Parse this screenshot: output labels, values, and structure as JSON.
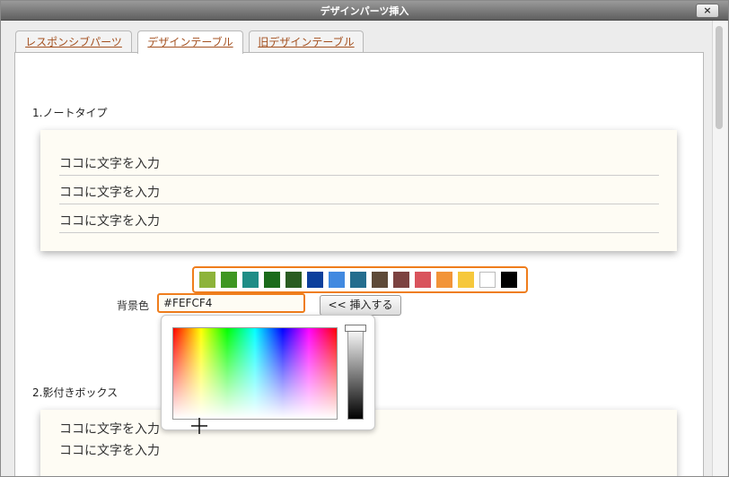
{
  "window": {
    "title": "デザインパーツ挿入",
    "close_label": "×"
  },
  "tabs": [
    {
      "label": "レスポンシブパーツ",
      "active": false
    },
    {
      "label": "デザインテーブル",
      "active": true
    },
    {
      "label": "旧デザインテーブル",
      "active": false
    }
  ],
  "sections": [
    {
      "heading": "1.ノートタイプ",
      "lines": [
        "ココに文字を入力",
        "ココに文字を入力",
        "ココに文字を入力"
      ]
    },
    {
      "heading": "2.影付きボックス",
      "lines": [
        "ココに文字を入力",
        "ココに文字を入力"
      ]
    }
  ],
  "palette": [
    "#8db33a",
    "#3f9622",
    "#1f8d86",
    "#1b6b1a",
    "#2a5c22",
    "#0c3f9c",
    "#4189e0",
    "#246d8e",
    "#5e4a38",
    "#7c4240",
    "#d9535c",
    "#f29438",
    "#f6c83c",
    "#ffffff",
    "#000000"
  ],
  "bgcolor": {
    "label": "背景色",
    "value": "#FEFCF4"
  },
  "insert_button": "<< 挿入する",
  "colors": {
    "accent": "#ef7d1c",
    "card_bg": "#fefcf4",
    "tab_text": "#a4501f"
  }
}
